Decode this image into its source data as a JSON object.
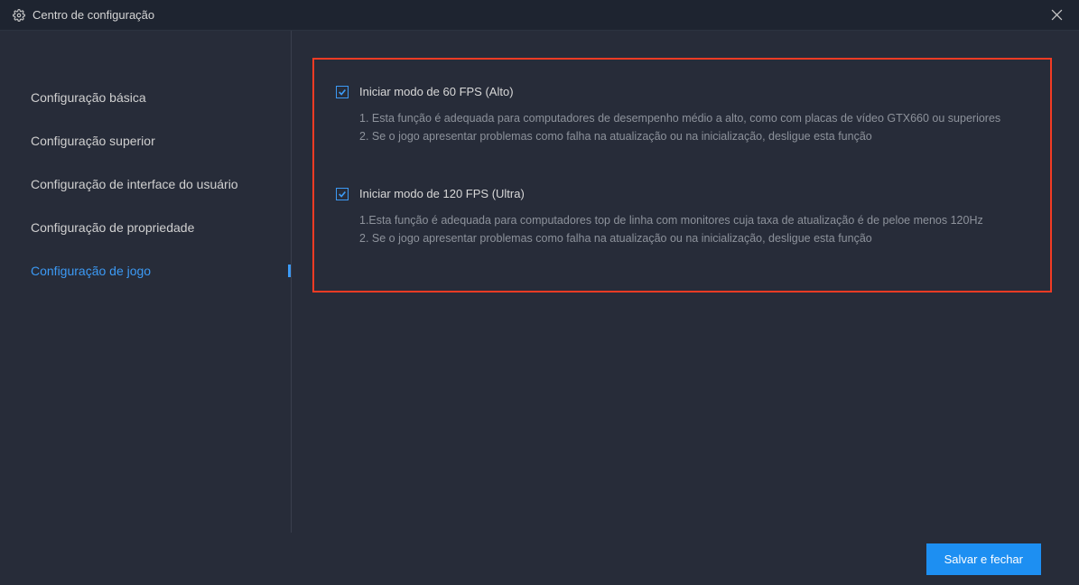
{
  "window": {
    "title": "Centro de configuração"
  },
  "sidebar": {
    "items": [
      {
        "label": "Configuração básica"
      },
      {
        "label": "Configuração superior"
      },
      {
        "label": "Configuração de interface do usuário"
      },
      {
        "label": "Configuração de propriedade"
      },
      {
        "label": "Configuração de jogo"
      }
    ],
    "active_index": 4
  },
  "options": {
    "fps60": {
      "label": "Iniciar modo de 60 FPS (Alto)",
      "checked": true,
      "desc1": "1. Esta função é adequada para computadores de desempenho médio a alto, como com placas de vídeo GTX660 ou superiores",
      "desc2": "2. Se o jogo apresentar problemas como falha na atualização ou na inicialização, desligue esta função"
    },
    "fps120": {
      "label": "Iniciar modo de 120 FPS (Ultra)",
      "checked": true,
      "desc1": "1.Esta função é adequada para computadores top de linha com monitores cuja taxa de atualização é de peloe menos 120Hz",
      "desc2": "2. Se o jogo apresentar problemas como falha na atualização ou na inicialização, desligue esta função"
    }
  },
  "footer": {
    "save_label": "Salvar e fechar"
  },
  "colors": {
    "accent": "#3c9af5",
    "button": "#1d8ff2",
    "highlight_border": "#f23b24",
    "bg_main": "#272c39",
    "bg_title": "#1e2430"
  }
}
